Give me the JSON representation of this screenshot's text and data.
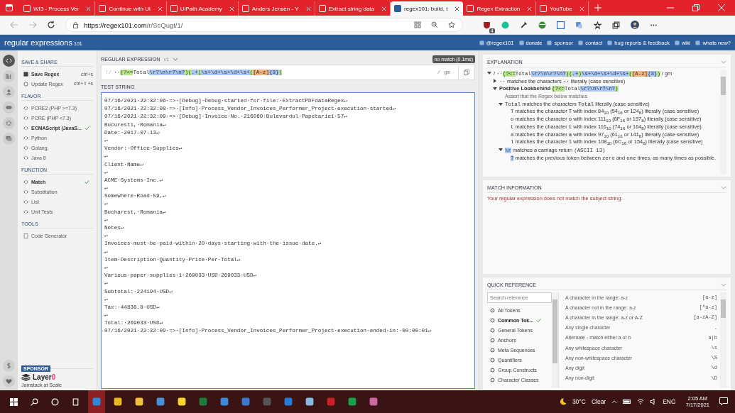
{
  "browser": {
    "tabs": [
      {
        "title": "WI3 - Process Ver",
        "selected": false
      },
      {
        "title": "Continue with Ui",
        "selected": false
      },
      {
        "title": "UiPath Academy",
        "selected": false
      },
      {
        "title": "Anders Jensen - Y",
        "selected": false
      },
      {
        "title": "Extract string data",
        "selected": false
      },
      {
        "title": "regex101: build, t",
        "selected": true
      },
      {
        "title": "Regex Extraction",
        "selected": false
      },
      {
        "title": "YouTube",
        "selected": false
      }
    ],
    "url_host": "https://regex101.com",
    "url_path": "/r/ScQugt/1/",
    "extension_badge": "4"
  },
  "header": {
    "logo": "regular expressions",
    "logo_suffix": "101",
    "links": [
      "@regex101",
      "donate",
      "sponsor",
      "contact",
      "bug reports & feedback",
      "wiki",
      "whats new?"
    ]
  },
  "nav_rail": [
    {
      "selected": true
    },
    {
      "selected": false
    },
    {
      "selected": false
    },
    {
      "selected": false
    },
    {
      "selected": false
    },
    {
      "selected": false
    }
  ],
  "sidebar": {
    "sections": [
      {
        "title": "SAVE & SHARE",
        "kind": "actions",
        "items": [
          {
            "label": "Save Regex",
            "shortcut": "ctrl+s",
            "primary": true
          },
          {
            "label": "Update Regex",
            "shortcut": "ctrl+⇧+s",
            "primary": false
          }
        ]
      },
      {
        "title": "FLAVOR",
        "kind": "choices",
        "items": [
          {
            "label": "PCRE2 (PHP >=7.3)",
            "selected": false
          },
          {
            "label": "PCRE (PHP <7.3)",
            "selected": false
          },
          {
            "label": "ECMAScript (JavaS...",
            "selected": true
          },
          {
            "label": "Python",
            "selected": false
          },
          {
            "label": "Golang",
            "selected": false
          },
          {
            "label": "Java 8",
            "selected": false
          }
        ]
      },
      {
        "title": "FUNCTION",
        "kind": "choices",
        "items": [
          {
            "label": "Match",
            "selected": true
          },
          {
            "label": "Substitution",
            "selected": false
          },
          {
            "label": "List",
            "selected": false
          },
          {
            "label": "Unit Tests",
            "selected": false
          }
        ]
      },
      {
        "title": "TOOLS",
        "kind": "tools",
        "items": [
          {
            "label": "Code Generator"
          }
        ]
      }
    ],
    "sponsor": {
      "badge": "SPONSOR",
      "name": "Layer",
      "name_suffix": "0",
      "tagline": "Jamstack at Scale"
    }
  },
  "regex": {
    "title": "REGULAR EXPRESSION",
    "version": "v1",
    "status": "no match (0.1ms)",
    "lead": "!/",
    "flags": "/ gm",
    "segments": [
      {
        "kind": "plain",
        "text": "··"
      },
      {
        "kind": "group",
        "text": "(?<="
      },
      {
        "kind": "plain",
        "text": "Total"
      },
      {
        "kind": "escape",
        "text": "\\r?\\n\\r?\\n?"
      },
      {
        "kind": "group",
        "text": ")("
      },
      {
        "kind": "escape",
        "text": ".+"
      },
      {
        "kind": "group",
        "text": ")"
      },
      {
        "kind": "escape",
        "text": "\\s+\\d+\\s+\\d+\\s+"
      },
      {
        "kind": "group",
        "text": "("
      },
      {
        "kind": "class",
        "text": "[A-z]"
      },
      {
        "kind": "escape",
        "text": "{3}"
      },
      {
        "kind": "group",
        "text": ")"
      }
    ]
  },
  "test_string": {
    "title": "TEST STRING",
    "lines": [
      "07/16/2021·22:32:06·=>·[Debug]·Debug·started·for·file:·ExtractPDFdataRegex↵",
      "07/16/2021·22:32:08·=>·[Info]·Process_Vendor_Invoices_Performer_Project·execution·started↵",
      "07/16/2021·22:32:09·=>·[Debug]·Invoice·No.·216060·Bulevardul·Papetariei·57↵",
      "Bucuresti,·Romania↵",
      "Date:·2017-07-13↵",
      "↵",
      "Vendor:·Office·Supplies↵",
      "↵",
      "Client·Name↵",
      "↵",
      "ACME·Systems·Inc.↵",
      "↵",
      "Somewhere·Road·59,↵",
      "↵",
      "Bucharest,·Romania↵",
      "↵",
      "Notes↵",
      "↵",
      "Invoices·must·be·paid·within·20·days·starting·with·the·issue·date.↵",
      "↵",
      "Item·Description·Quantity·Price·Per·Total↵",
      "↵",
      "Various·paper·supplies·1·269033·USD·269033·USD↵",
      "↵",
      "Subtotal:·224194·USD↵",
      "↵",
      "Tax:·44838.8·USD↵",
      "↵",
      "Total:·269033·USD↵",
      "07/16/2021·22:32:09·=>·[Info]·Process_Vendor_Invoices_Performer_Project·execution·ended·in:·00:00:01↵"
    ]
  },
  "explanation": {
    "title": "EXPLANATION",
    "tree": [
      {
        "expanded": true,
        "segments": [
          {
            "kind": "text",
            "text": "/ "
          },
          {
            "kind": "mono",
            "text": "··"
          },
          {
            "kind": "group",
            "text": "(?<="
          },
          {
            "kind": "mono",
            "text": "Total"
          },
          {
            "kind": "escape",
            "text": "\\r?\\n\\r?\\n?"
          },
          {
            "kind": "group",
            "text": ")("
          },
          {
            "kind": "escape",
            "text": ".+"
          },
          {
            "kind": "group",
            "text": ")"
          },
          {
            "kind": "escape",
            "text": "\\s+\\d+\\s+\\d+\\s+"
          },
          {
            "kind": "group",
            "text": "("
          },
          {
            "kind": "class",
            "text": "[A-z]"
          },
          {
            "kind": "escape",
            "text": "{3}"
          },
          {
            "kind": "group",
            "text": ")"
          },
          {
            "kind": "text",
            "text": " / gm"
          }
        ],
        "children": [
          {
            "expanded": false,
            "segments": [
              {
                "kind": "mono",
                "text": "··"
              },
              {
                "kind": "text",
                "text": " matches the characters "
              },
              {
                "kind": "code",
                "text": "··"
              },
              {
                "kind": "text",
                "text": " literally (case sensitive)"
              }
            ]
          },
          {
            "expanded": true,
            "segments": [
              {
                "kind": "bold",
                "text": "Positive Lookbehind "
              },
              {
                "kind": "group",
                "text": "(?<="
              },
              {
                "kind": "mono",
                "text": "Total"
              },
              {
                "kind": "escape",
                "text": "\\r?\\n\\r?\\n?"
              },
              {
                "kind": "group",
                "text": ")"
              }
            ],
            "children": [
              {
                "segments": [
                  {
                    "kind": "note",
                    "text": "Assert that the Regex below matches"
                  }
                ]
              },
              {
                "expanded": true,
                "segments": [
                  {
                    "kind": "mono",
                    "text": "Total"
                  },
                  {
                    "kind": "text",
                    "text": " matches the characters "
                  },
                  {
                    "kind": "code",
                    "text": "Total"
                  },
                  {
                    "kind": "text",
                    "text": " literally (case sensitive)"
                  }
                ],
                "children": [
                  {
                    "segments": [
                      {
                        "kind": "mono",
                        "text": "T"
                      },
                      {
                        "kind": "text",
                        "text": " matches the character "
                      },
                      {
                        "kind": "code",
                        "text": "T"
                      },
                      {
                        "kind": "text",
                        "text": " with index 84$_{10}$ (54$_{16}$ or 124$_{8}$) literally (case sensitive)"
                      }
                    ]
                  },
                  {
                    "segments": [
                      {
                        "kind": "mono",
                        "text": "o"
                      },
                      {
                        "kind": "text",
                        "text": " matches the character "
                      },
                      {
                        "kind": "code",
                        "text": "o"
                      },
                      {
                        "kind": "text",
                        "text": " with index 111$_{10}$ (6F$_{16}$ or 157$_{8}$) literally (case sensitive)"
                      }
                    ]
                  },
                  {
                    "segments": [
                      {
                        "kind": "mono",
                        "text": "t"
                      },
                      {
                        "kind": "text",
                        "text": " matches the character "
                      },
                      {
                        "kind": "code",
                        "text": "t"
                      },
                      {
                        "kind": "text",
                        "text": " with index 116$_{10}$ (74$_{16}$ or 164$_{8}$) literally (case sensitive)"
                      }
                    ]
                  },
                  {
                    "segments": [
                      {
                        "kind": "mono",
                        "text": "a"
                      },
                      {
                        "kind": "text",
                        "text": " matches the character "
                      },
                      {
                        "kind": "code",
                        "text": "a"
                      },
                      {
                        "kind": "text",
                        "text": " with index 97$_{10}$ (61$_{16}$ or 141$_{8}$) literally (case sensitive)"
                      }
                    ]
                  },
                  {
                    "segments": [
                      {
                        "kind": "mono",
                        "text": "l"
                      },
                      {
                        "kind": "text",
                        "text": " matches the character "
                      },
                      {
                        "kind": "code",
                        "text": "l"
                      },
                      {
                        "kind": "text",
                        "text": " with index 108$_{10}$ (6C$_{16}$ or 154$_{8}$) literally (case sensitive)"
                      }
                    ]
                  }
                ]
              },
              {
                "expanded": true,
                "segments": [
                  {
                    "kind": "escape",
                    "text": "\\r"
                  },
                  {
                    "kind": "text",
                    "text": " matches a carriage return "
                  },
                  {
                    "kind": "mono",
                    "text": "(ASCII 13)"
                  }
                ],
                "children": [
                  {
                    "segments": [
                      {
                        "kind": "escape",
                        "text": "?"
                      },
                      {
                        "kind": "text",
                        "text": " matches the previous token between "
                      },
                      {
                        "kind": "mono",
                        "text": "zero"
                      },
                      {
                        "kind": "text",
                        "text": " and "
                      },
                      {
                        "kind": "mono",
                        "text": "one"
                      },
                      {
                        "kind": "text",
                        "text": " times, as many times as possible."
                      }
                    ]
                  }
                ]
              }
            ]
          }
        ]
      }
    ]
  },
  "match_information": {
    "title": "MATCH INFORMATION",
    "message": "Your regular expression does not match the subject string."
  },
  "quick_reference": {
    "title": "QUICK REFERENCE",
    "search_placeholder": "Search reference",
    "categories": [
      {
        "label": "All Tokens",
        "selected": false
      },
      {
        "label": "Common Tok...",
        "selected": true
      },
      {
        "label": "General Tokens",
        "selected": false
      },
      {
        "label": "Anchors",
        "selected": false
      },
      {
        "label": "Meta Sequences",
        "selected": false
      },
      {
        "label": "Quantifiers",
        "selected": false
      },
      {
        "label": "Group Constructs",
        "selected": false
      },
      {
        "label": "Character Classes",
        "selected": false
      }
    ],
    "entries": [
      {
        "description": "A character in the range: a-z",
        "token": "[a-z]"
      },
      {
        "description": "A character not in the range: a-z",
        "token": "[^a-z]"
      },
      {
        "description": "A character in the range: a-z or A-Z",
        "token": "[a-zA-Z]"
      },
      {
        "description": "Any single character",
        "token": "."
      },
      {
        "description": "Alternate - match either a or b",
        "token": "a|b"
      },
      {
        "description": "Any whitespace character",
        "token": "\\s"
      },
      {
        "description": "Any non-whitespace character",
        "token": "\\S"
      },
      {
        "description": "Any digit",
        "token": "\\d"
      },
      {
        "description": "Any non-digit",
        "token": "\\D"
      }
    ]
  },
  "taskbar": {
    "weather": "30°C",
    "condition": "Clear",
    "language": "ENG",
    "time": "2:05 AM",
    "date": "7/17/2021"
  }
}
